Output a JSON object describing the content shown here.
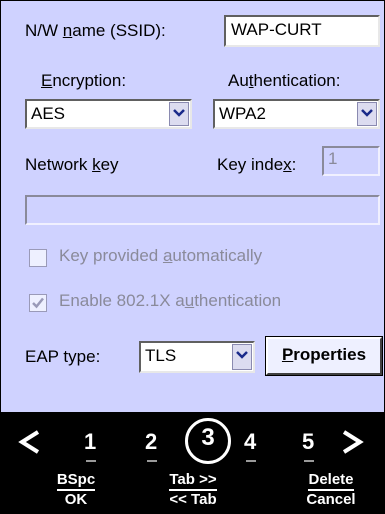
{
  "form": {
    "ssid_label_pre": "N/W ",
    "ssid_label_ul": "n",
    "ssid_label_post": "ame (SSID):",
    "ssid_value": "WAP-CURT",
    "encryption_label_pre": "",
    "encryption_label_ul": "E",
    "encryption_label_post": "ncryption:",
    "authentication_label_pre": "Au",
    "authentication_label_ul": "t",
    "authentication_label_post": "hentication:",
    "encryption_value": "AES",
    "authentication_value": "WPA2",
    "network_key_label_pre": "Network ",
    "network_key_label_ul": "k",
    "network_key_label_post": "ey",
    "key_index_label_pre": "Key inde",
    "key_index_label_ul": "x",
    "key_index_label_post": ":",
    "key_index_value": "1",
    "network_key_value": "",
    "key_auto_pre": "Key provided ",
    "key_auto_ul": "a",
    "key_auto_post": "utomatically",
    "key_auto_checked": false,
    "enable_8021x_pre": "Enable 802.1X a",
    "enable_8021x_ul": "u",
    "enable_8021x_post": "thentication",
    "enable_8021x_checked": true,
    "eap_label": "EAP type:",
    "eap_value": "TLS",
    "properties_ul": "P",
    "properties_post": "roperties"
  },
  "keyboard": {
    "left_arrow": "ᐸ",
    "right_arrow": "ᐳ",
    "digits": [
      "1",
      "2",
      "3",
      "4",
      "5"
    ],
    "selected_digit": "3",
    "softkeys": [
      {
        "top": "BSpc",
        "bottom": "OK"
      },
      {
        "top": "Tab >>",
        "bottom": "<< Tab"
      },
      {
        "top": "Delete",
        "bottom": "Cancel"
      }
    ]
  },
  "colors": {
    "panel_bg": "#cfd2ff",
    "keyboard_bg": "#000000",
    "disabled_text": "#8a8a9a"
  }
}
